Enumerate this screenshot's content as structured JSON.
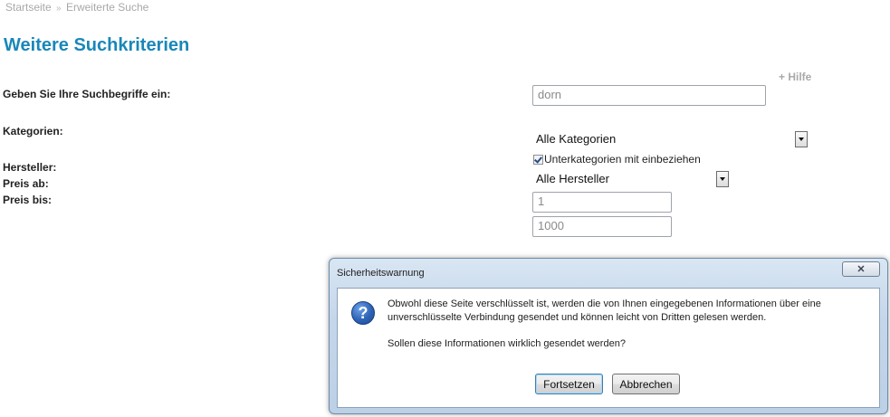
{
  "breadcrumb": {
    "home": "Startseite",
    "separator": "»",
    "current": "Erweiterte Suche"
  },
  "page": {
    "title": "Weitere Suchkriterien",
    "help_link": "+ Hilfe"
  },
  "form": {
    "search_label": "Geben Sie Ihre Suchbegriffe ein:",
    "search_value": "dorn",
    "categories_label": "Kategorien:",
    "categories_selected": "Alle Kategorien",
    "include_subcategories_label": "Unterkategorien mit einbeziehen",
    "include_subcategories_checked": true,
    "manufacturer_label": "Hersteller:",
    "manufacturer_selected": "Alle Hersteller",
    "price_from_label": "Preis ab:",
    "price_from_value": "1",
    "price_to_label": "Preis bis:",
    "price_to_value": "1000"
  },
  "dialog": {
    "title": "Sicherheitswarnung",
    "close_glyph": "✕",
    "icon": "question-icon",
    "message_line1": "Obwohl diese Seite verschlüsselt ist, werden die von Ihnen eingegebenen Informationen über eine",
    "message_line2": "unverschlüsselte Verbindung gesendet und können leicht von Dritten gelesen werden.",
    "question": "Sollen diese Informationen wirklich gesendet werden?",
    "continue_label": "Fortsetzen",
    "cancel_label": "Abbrechen"
  }
}
